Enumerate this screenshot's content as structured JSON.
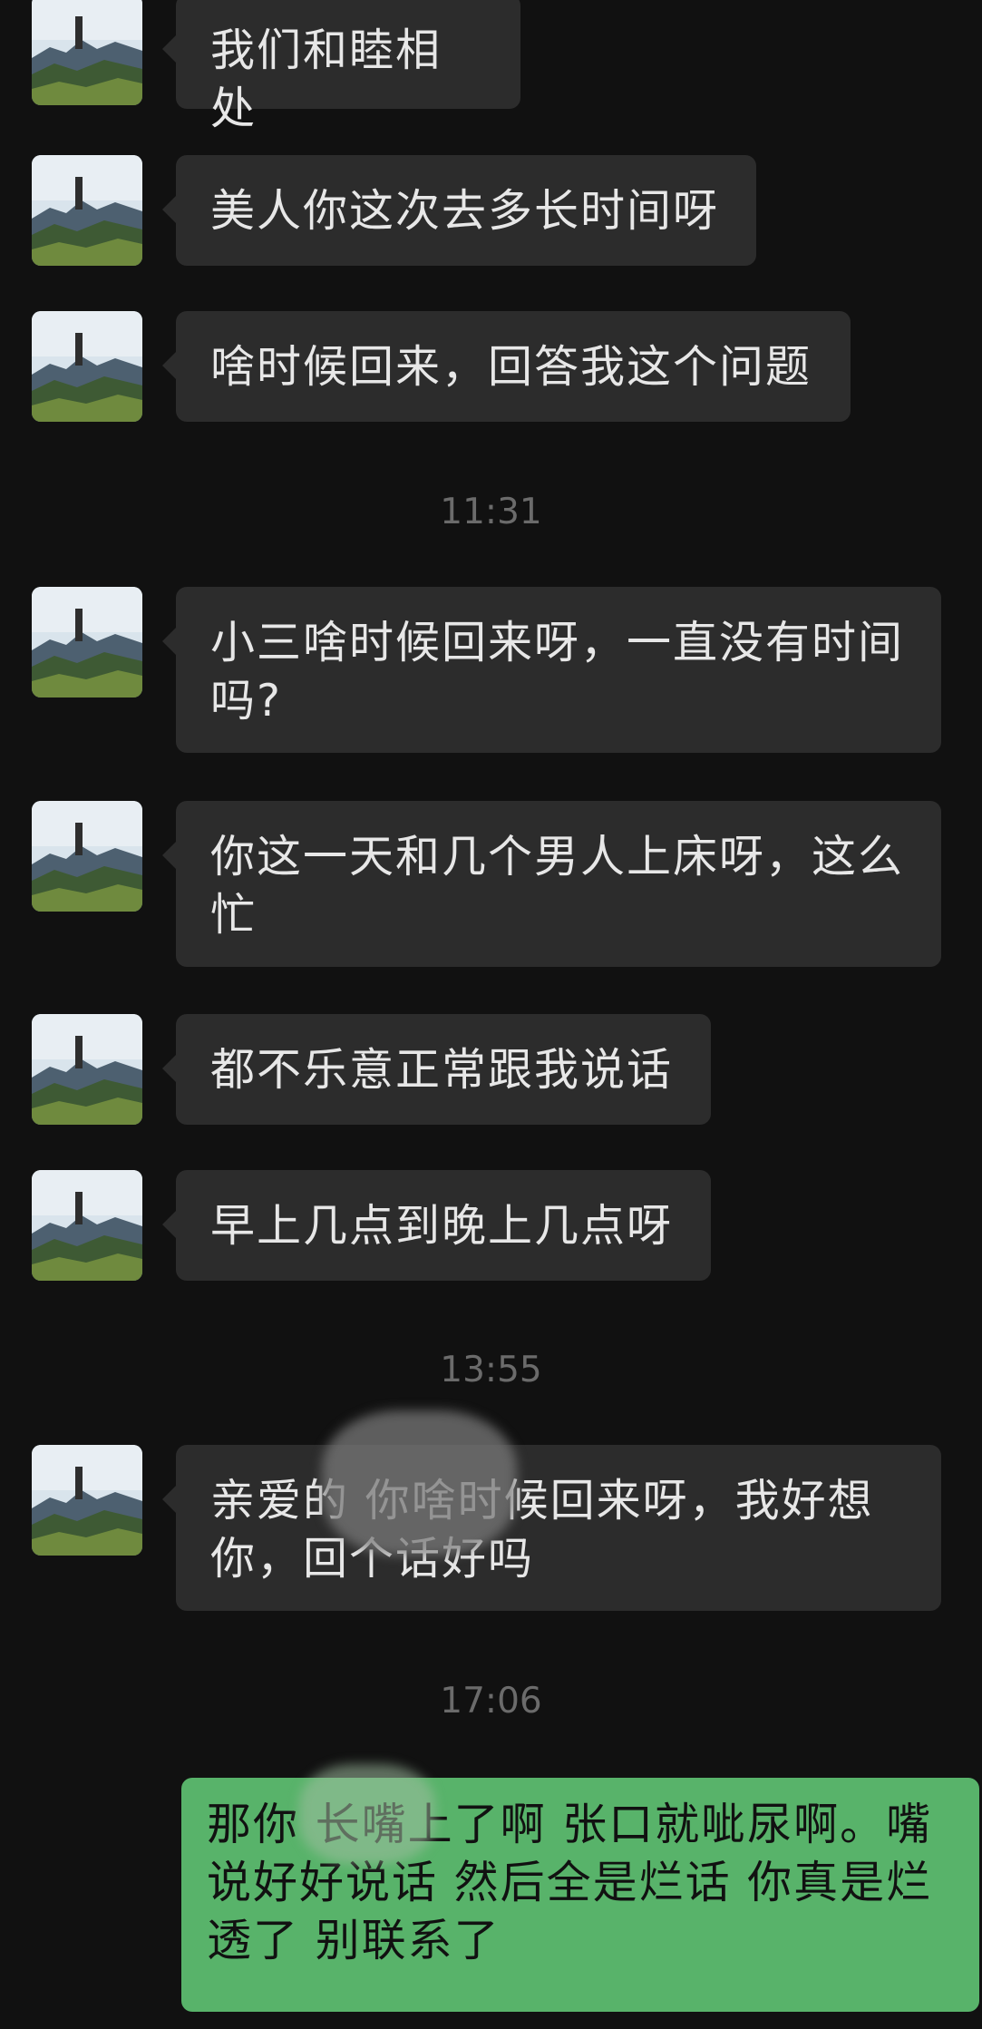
{
  "colors": {
    "background": "#111111",
    "incoming_bubble": "#2c2c2c",
    "incoming_text": "#e7e7e7",
    "outgoing_bubble": "#58b36a",
    "outgoing_text": "#111111",
    "timestamp_text": "#6b6b6b"
  },
  "messages": [
    {
      "text": "我们和睦相处"
    },
    {
      "text": "美人你这次去多长时间呀"
    },
    {
      "text": "啥时候回来，回答我这个问题"
    },
    {
      "text": "小三啥时候回来呀，一直没有时间吗?"
    },
    {
      "text": "你这一天和几个男人上床呀，这么忙"
    },
    {
      "text": "都不乐意正常跟我说话"
    },
    {
      "text": "早上几点到晚上几点呀"
    },
    {
      "text": "亲爱的 你啥时候回来呀，我好想你，回个话好吗"
    },
    {
      "text": "那你 长嘴上了啊 张口就呲尿啊。嘴说好好说话 然后全是烂话 你真是烂透了 别联系了"
    }
  ],
  "timestamps": [
    "11:31",
    "13:55",
    "17:06"
  ]
}
